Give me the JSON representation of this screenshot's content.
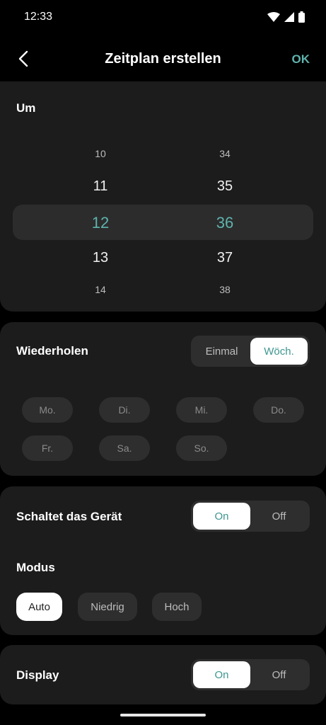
{
  "status": {
    "time": "12:33",
    "icons": [
      "wifi-icon",
      "signal-icon",
      "battery-icon"
    ]
  },
  "header": {
    "title": "Zeitplan erstellen",
    "ok_label": "OK",
    "back_icon": "chevron-left-icon"
  },
  "time_picker": {
    "label": "Um",
    "hours": [
      "10",
      "11",
      "12",
      "13",
      "14"
    ],
    "minutes": [
      "34",
      "35",
      "36",
      "37",
      "38"
    ],
    "selected_hour": "12",
    "selected_minute": "36"
  },
  "repeat": {
    "label": "Wiederholen",
    "options": [
      "Einmal",
      "Wöch."
    ],
    "selected": "Wöch.",
    "days": [
      "Mo.",
      "Di.",
      "Mi.",
      "Do.",
      "Fr.",
      "Sa.",
      "So."
    ]
  },
  "switch_device": {
    "label": "Schaltet das Gerät",
    "options": [
      "On",
      "Off"
    ],
    "selected": "On"
  },
  "mode": {
    "label": "Modus",
    "options": [
      "Auto",
      "Niedrig",
      "Hoch"
    ],
    "selected": "Auto"
  },
  "display": {
    "label": "Display",
    "options": [
      "On",
      "Off"
    ],
    "selected": "On"
  },
  "colors": {
    "accent": "#5fb3ad",
    "background": "#000000",
    "card": "#1c1c1c"
  }
}
